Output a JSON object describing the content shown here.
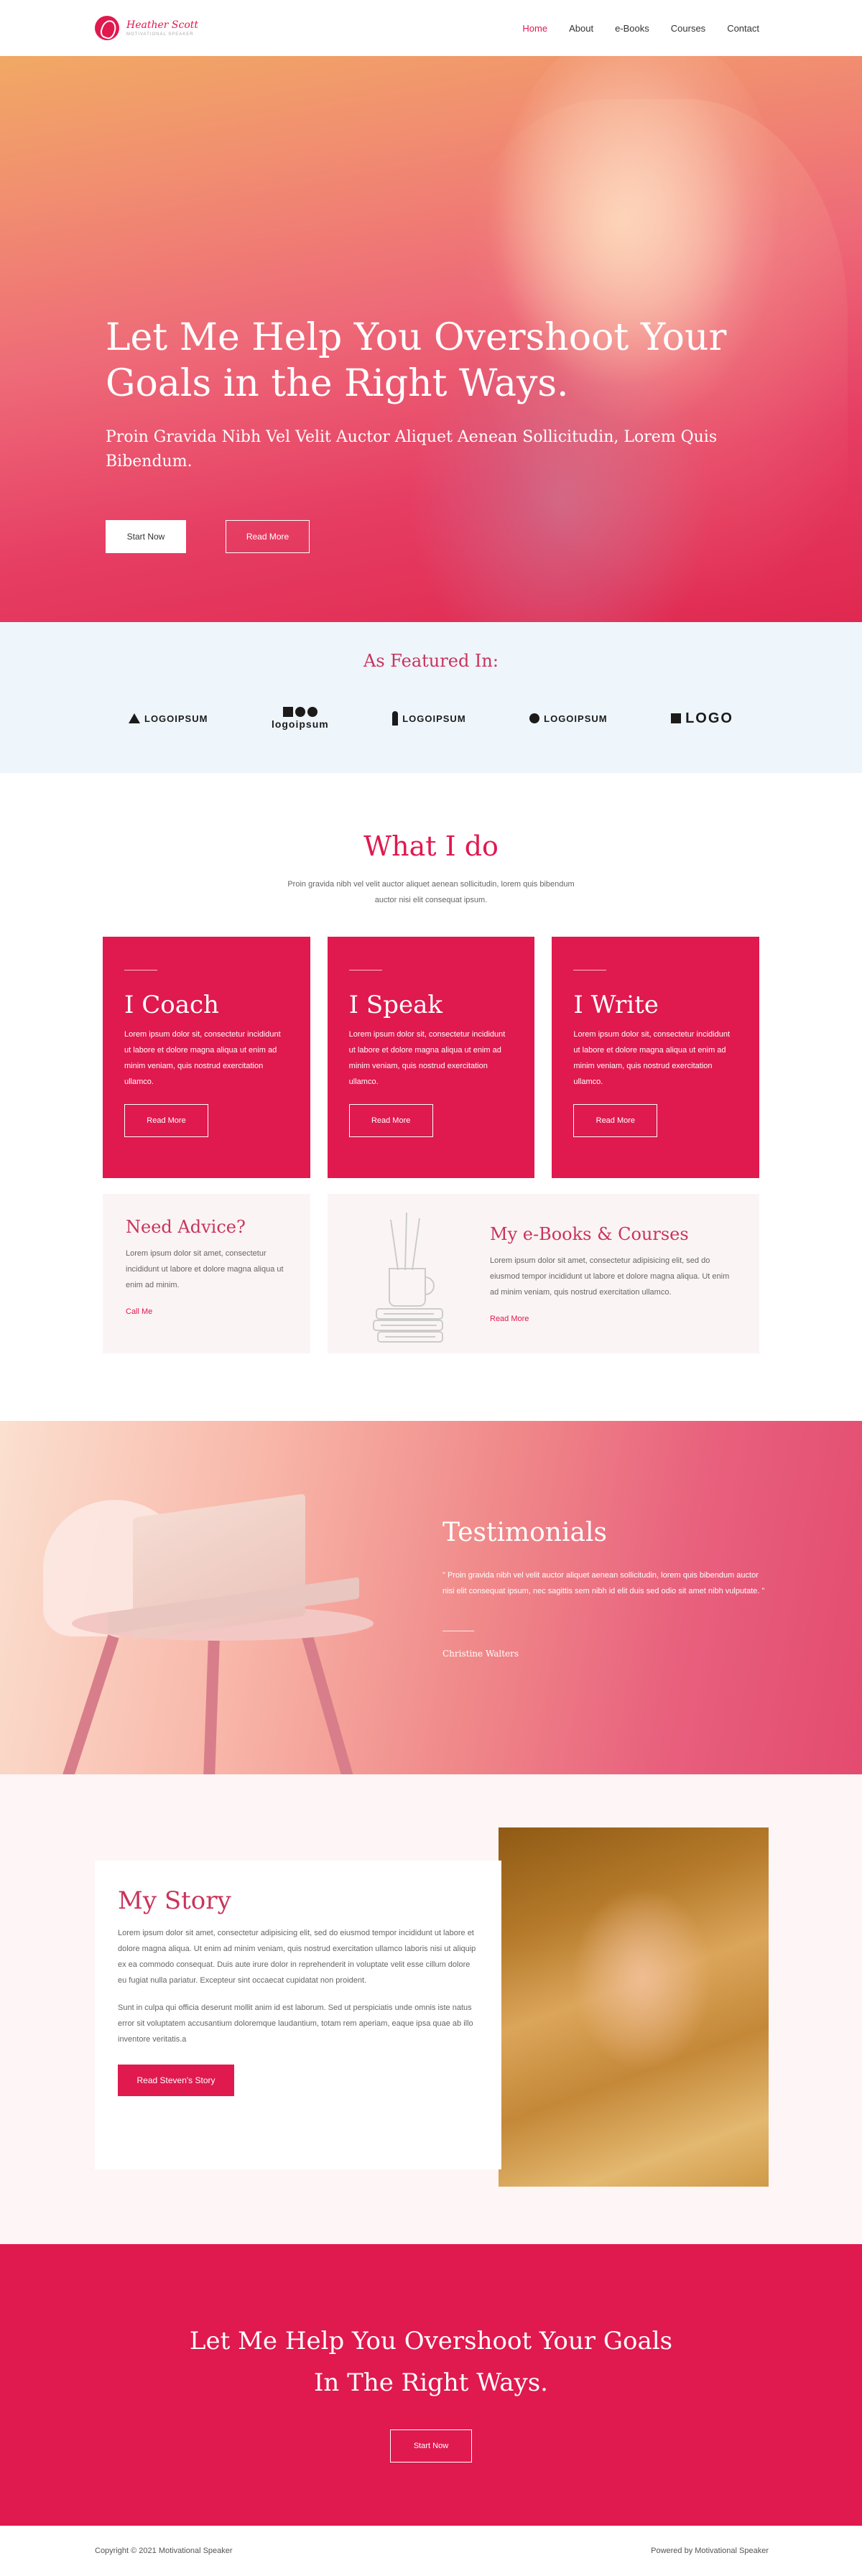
{
  "brand": {
    "name": "Heather Scott",
    "tagline": "MOTIVATIONAL SPEAKER"
  },
  "nav": {
    "items": [
      {
        "label": "Home",
        "active": true
      },
      {
        "label": "About"
      },
      {
        "label": "e-Books"
      },
      {
        "label": "Courses"
      },
      {
        "label": "Contact"
      }
    ]
  },
  "hero": {
    "title": "Let Me Help You Overshoot Your Goals in the Right Ways.",
    "subtitle": "Proin Gravida Nibh Vel Velit Auctor Aliquet Aenean Sollicitudin, Lorem Quis Bibendum.",
    "primary_btn": "Start Now",
    "secondary_btn": "Read More"
  },
  "featured": {
    "title": "As Featured In:",
    "logos": [
      "LOGOIPSUM",
      "logoipsum",
      "LOGOIPSUM",
      "LOGOIPSUM",
      "LOGO"
    ]
  },
  "whatido": {
    "title": "What I do",
    "lead": "Proin gravida nibh vel velit auctor aliquet aenean sollicitudin, lorem quis bibendum auctor nisi elit consequat ipsum.",
    "cards": [
      {
        "title": "I Coach",
        "text": "Lorem ipsum dolor sit, consectetur incididunt ut labore et dolore magna aliqua ut enim ad minim veniam, quis nostrud exercitation ullamco.",
        "btn": "Read More"
      },
      {
        "title": "I Speak",
        "text": "Lorem ipsum dolor sit, consectetur incididunt ut labore et dolore magna aliqua ut enim ad minim veniam, quis nostrud exercitation ullamco.",
        "btn": "Read More"
      },
      {
        "title": "I Write",
        "text": "Lorem ipsum dolor sit, consectetur incididunt ut labore et dolore magna aliqua ut enim ad minim veniam, quis nostrud exercitation ullamco.",
        "btn": "Read More"
      }
    ],
    "advice": {
      "title": "Need Advice?",
      "text": "Lorem ipsum dolor sit amet, consectetur incididunt ut labore et dolore magna aliqua ut enim ad minim.",
      "link": "Call Me"
    },
    "ebooks": {
      "title": "My e-Books & Courses",
      "text": "Lorem ipsum dolor sit amet, consectetur adipisicing elit, sed do eiusmod tempor incididunt ut labore et dolore magna aliqua. Ut enim ad minim veniam, quis nostrud exercitation ullamco.",
      "link": "Read More"
    }
  },
  "testimonials": {
    "title": "Testimonials",
    "quote": "\" Proin gravida nibh vel velit auctor aliquet aenean sollicitudin, lorem quis bibendum auctor nisi elit consequat ipsum, nec sagittis sem nibh id elit duis sed odio sit amet nibh vulputate. \"",
    "author": "Christine Walters"
  },
  "story": {
    "title": "My Story",
    "p1": "Lorem ipsum dolor sit amet, consectetur adipisicing elit, sed do eiusmod tempor incididunt ut labore et dolore magna aliqua. Ut enim ad minim veniam, quis nostrud exercitation ullamco laboris nisi ut aliquip ex ea commodo consequat. Duis aute irure dolor in reprehenderit in voluptate velit esse cillum dolore eu fugiat nulla pariatur. Excepteur sint occaecat cupidatat non proident.",
    "p2": "Sunt in culpa qui officia deserunt mollit anim id est laborum. Sed ut perspiciatis unde omnis iste natus error sit voluptatem accusantium doloremque laudantium, totam rem aperiam, eaque ipsa quae ab illo inventore veritatis.a",
    "btn": "Read Steven's Story"
  },
  "cta": {
    "title": "Let Me Help You Overshoot Your Goals In The Right Ways.",
    "btn": "Start Now"
  },
  "footer": {
    "left": "Copyright © 2021 Motivational Speaker",
    "right": "Powered by Motivational Speaker"
  },
  "colors": {
    "accent": "#e0194f",
    "heading_pink": "#c9345b",
    "featured_bg": "#eef5fb",
    "soft_bg": "#fbf4f5"
  }
}
